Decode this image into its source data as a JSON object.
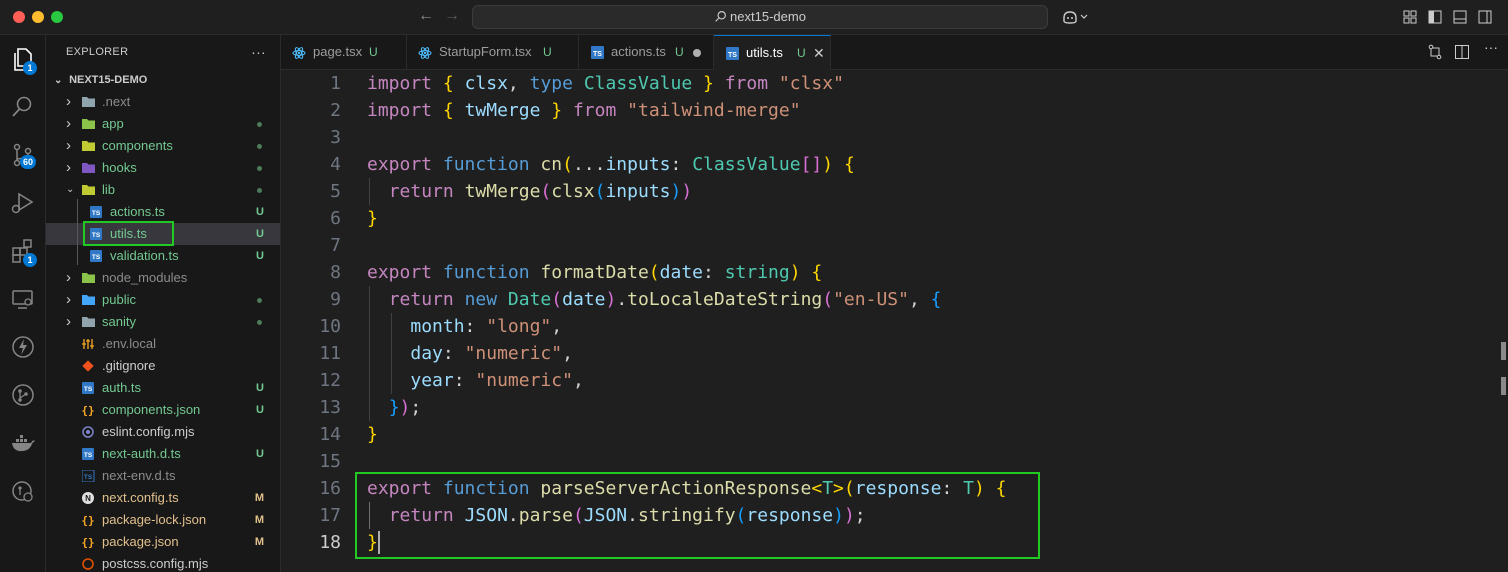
{
  "titlebar": {
    "search_text": "next15-demo"
  },
  "activity": {
    "explorer_badge": "1",
    "scm_badge": "60",
    "extensions_badge": "1"
  },
  "sidebar": {
    "title": "EXPLORER",
    "project": "NEXT15-DEMO",
    "items": [
      {
        "name": ".next",
        "type": "folder",
        "git": "",
        "dot": false
      },
      {
        "name": "app",
        "type": "folder",
        "git": "",
        "dot": true
      },
      {
        "name": "components",
        "type": "folder",
        "git": "",
        "dot": true
      },
      {
        "name": "hooks",
        "type": "folder",
        "git": "",
        "dot": true
      },
      {
        "name": "lib",
        "type": "folder-open",
        "git": "",
        "dot": true
      },
      {
        "name": "actions.ts",
        "type": "ts",
        "git": "U",
        "dot": false
      },
      {
        "name": "utils.ts",
        "type": "ts",
        "git": "U",
        "dot": false
      },
      {
        "name": "validation.ts",
        "type": "ts",
        "git": "U",
        "dot": false
      },
      {
        "name": "node_modules",
        "type": "folder",
        "git": "",
        "dot": false
      },
      {
        "name": "public",
        "type": "folder",
        "git": "",
        "dot": true
      },
      {
        "name": "sanity",
        "type": "folder",
        "git": "",
        "dot": true
      },
      {
        "name": ".env.local",
        "type": "env",
        "git": "",
        "dot": false
      },
      {
        "name": ".gitignore",
        "type": "git",
        "git": "",
        "dot": false
      },
      {
        "name": "auth.ts",
        "type": "ts",
        "git": "U",
        "dot": false
      },
      {
        "name": "components.json",
        "type": "json",
        "git": "U",
        "dot": false
      },
      {
        "name": "eslint.config.mjs",
        "type": "eslint",
        "git": "",
        "dot": false
      },
      {
        "name": "next-auth.d.ts",
        "type": "ts",
        "git": "U",
        "dot": false
      },
      {
        "name": "next-env.d.ts",
        "type": "ts",
        "git": "",
        "dot": false
      },
      {
        "name": "next.config.ts",
        "type": "next",
        "git": "M",
        "dot": false
      },
      {
        "name": "package-lock.json",
        "type": "json",
        "git": "M",
        "dot": false
      },
      {
        "name": "package.json",
        "type": "json",
        "git": "M",
        "dot": false
      },
      {
        "name": "postcss.config.mjs",
        "type": "postcss",
        "git": "",
        "dot": false
      }
    ]
  },
  "tabs": [
    {
      "label": "page.tsx",
      "git": "U",
      "icon": "react-icon"
    },
    {
      "label": "StartupForm.tsx",
      "git": "U",
      "icon": "react-icon"
    },
    {
      "label": "actions.ts",
      "git": "U",
      "icon": "ts-icon",
      "modified": true
    },
    {
      "label": "utils.ts",
      "git": "U",
      "icon": "ts-icon",
      "active": true
    }
  ],
  "editor": {
    "current_line": 18,
    "lines": [
      [
        [
          "kw2",
          "import"
        ],
        [
          "pl",
          " "
        ],
        [
          "br1",
          "{"
        ],
        [
          "pl",
          " "
        ],
        [
          "var",
          "clsx"
        ],
        [
          "pl",
          ", "
        ],
        [
          "kw",
          "type"
        ],
        [
          "pl",
          " "
        ],
        [
          "ty",
          "ClassValue"
        ],
        [
          "pl",
          " "
        ],
        [
          "br1",
          "}"
        ],
        [
          "pl",
          " "
        ],
        [
          "kw2",
          "from"
        ],
        [
          "pl",
          " "
        ],
        [
          "str",
          "\"clsx\""
        ]
      ],
      [
        [
          "kw2",
          "import"
        ],
        [
          "pl",
          " "
        ],
        [
          "br1",
          "{"
        ],
        [
          "pl",
          " "
        ],
        [
          "var",
          "twMerge"
        ],
        [
          "pl",
          " "
        ],
        [
          "br1",
          "}"
        ],
        [
          "pl",
          " "
        ],
        [
          "kw2",
          "from"
        ],
        [
          "pl",
          " "
        ],
        [
          "str",
          "\"tailwind-merge\""
        ]
      ],
      [],
      [
        [
          "kw2",
          "export"
        ],
        [
          "pl",
          " "
        ],
        [
          "kw",
          "function"
        ],
        [
          "pl",
          " "
        ],
        [
          "fn",
          "cn"
        ],
        [
          "br1",
          "("
        ],
        [
          "pl",
          "..."
        ],
        [
          "var",
          "inputs"
        ],
        [
          "pl",
          ": "
        ],
        [
          "ty",
          "ClassValue"
        ],
        [
          "br2",
          "[]"
        ],
        [
          "br1",
          ")"
        ],
        [
          "pl",
          " "
        ],
        [
          "br1",
          "{"
        ]
      ],
      [
        [
          "pl",
          "  "
        ],
        [
          "kw2",
          "return"
        ],
        [
          "pl",
          " "
        ],
        [
          "fn",
          "twMerge"
        ],
        [
          "br2",
          "("
        ],
        [
          "fn",
          "clsx"
        ],
        [
          "br3",
          "("
        ],
        [
          "var",
          "inputs"
        ],
        [
          "br3",
          ")"
        ],
        [
          "br2",
          ")"
        ]
      ],
      [
        [
          "br1",
          "}"
        ]
      ],
      [],
      [
        [
          "kw2",
          "export"
        ],
        [
          "pl",
          " "
        ],
        [
          "kw",
          "function"
        ],
        [
          "pl",
          " "
        ],
        [
          "fn",
          "formatDate"
        ],
        [
          "br1",
          "("
        ],
        [
          "var",
          "date"
        ],
        [
          "pl",
          ": "
        ],
        [
          "ty",
          "string"
        ],
        [
          "br1",
          ")"
        ],
        [
          "pl",
          " "
        ],
        [
          "br1",
          "{"
        ]
      ],
      [
        [
          "pl",
          "  "
        ],
        [
          "kw2",
          "return"
        ],
        [
          "pl",
          " "
        ],
        [
          "kw",
          "new"
        ],
        [
          "pl",
          " "
        ],
        [
          "ty",
          "Date"
        ],
        [
          "br2",
          "("
        ],
        [
          "var",
          "date"
        ],
        [
          "br2",
          ")"
        ],
        [
          "pl",
          "."
        ],
        [
          "fn",
          "toLocaleDateString"
        ],
        [
          "br2",
          "("
        ],
        [
          "str",
          "\"en-US\""
        ],
        [
          "pl",
          ", "
        ],
        [
          "br3",
          "{"
        ]
      ],
      [
        [
          "pl",
          "    "
        ],
        [
          "var",
          "month"
        ],
        [
          "pl",
          ": "
        ],
        [
          "str",
          "\"long\""
        ],
        [
          "pl",
          ","
        ]
      ],
      [
        [
          "pl",
          "    "
        ],
        [
          "var",
          "day"
        ],
        [
          "pl",
          ": "
        ],
        [
          "str",
          "\"numeric\""
        ],
        [
          "pl",
          ","
        ]
      ],
      [
        [
          "pl",
          "    "
        ],
        [
          "var",
          "year"
        ],
        [
          "pl",
          ": "
        ],
        [
          "str",
          "\"numeric\""
        ],
        [
          "pl",
          ","
        ]
      ],
      [
        [
          "pl",
          "  "
        ],
        [
          "br3",
          "}"
        ],
        [
          "br2",
          ")"
        ],
        [
          "pl",
          ";"
        ]
      ],
      [
        [
          "br1",
          "}"
        ]
      ],
      [],
      [
        [
          "kw2",
          "export"
        ],
        [
          "pl",
          " "
        ],
        [
          "kw",
          "function"
        ],
        [
          "pl",
          " "
        ],
        [
          "fn",
          "parseServerActionResponse"
        ],
        [
          "br1",
          "<"
        ],
        [
          "ty",
          "T"
        ],
        [
          "br1",
          ">"
        ],
        [
          "br1",
          "("
        ],
        [
          "var",
          "response"
        ],
        [
          "pl",
          ": "
        ],
        [
          "ty",
          "T"
        ],
        [
          "br1",
          ")"
        ],
        [
          "pl",
          " "
        ],
        [
          "br1",
          "{"
        ]
      ],
      [
        [
          "pl",
          "  "
        ],
        [
          "kw2",
          "return"
        ],
        [
          "pl",
          " "
        ],
        [
          "var",
          "JSON"
        ],
        [
          "pl",
          "."
        ],
        [
          "fn",
          "parse"
        ],
        [
          "br2",
          "("
        ],
        [
          "var",
          "JSON"
        ],
        [
          "pl",
          "."
        ],
        [
          "fn",
          "stringify"
        ],
        [
          "br3",
          "("
        ],
        [
          "var",
          "response"
        ],
        [
          "br3",
          ")"
        ],
        [
          "br2",
          ")"
        ],
        [
          "pl",
          ";"
        ]
      ],
      [
        [
          "br1",
          "}"
        ]
      ]
    ]
  },
  "colors": {
    "accent": "#0078d4",
    "highlight": "#22c922",
    "git_untracked": "#73c991",
    "git_modified": "#e2c08d"
  }
}
